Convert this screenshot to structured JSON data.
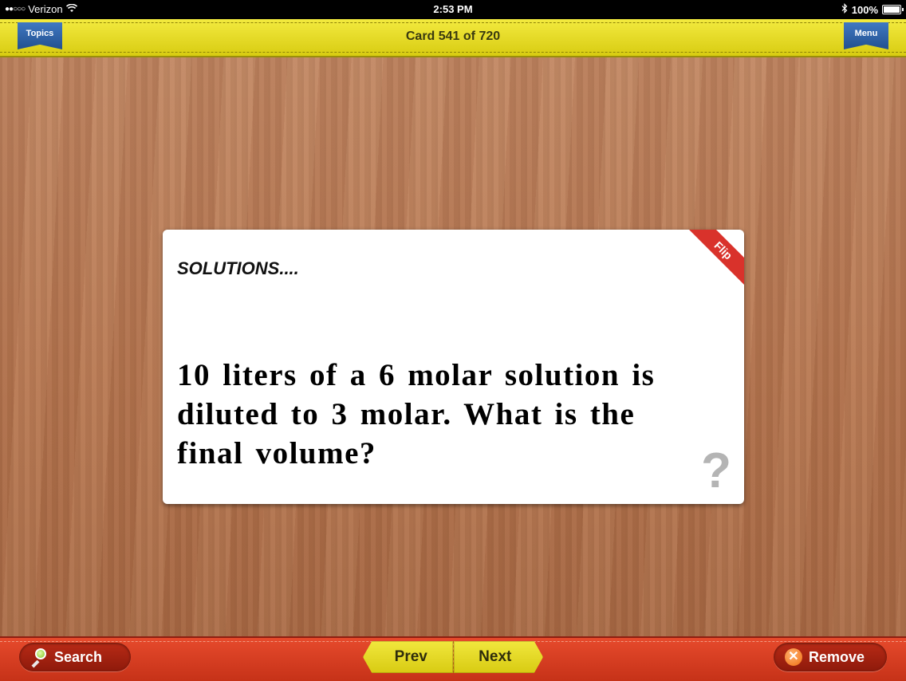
{
  "status_bar": {
    "carrier": "Verizon",
    "time": "2:53 PM",
    "battery": "100%",
    "battery_level": 1.0,
    "icons": [
      "signal-dots-icon",
      "wifi-icon",
      "bluetooth-icon",
      "battery-icon"
    ]
  },
  "header": {
    "topics_label": "Topics",
    "title": "Card 541 of 720",
    "menu_label": "Menu"
  },
  "card": {
    "topic": "SOLUTIONS....",
    "question": "10 liters of a 6 molar solution is diluted to 3 molar. What is the final volume?",
    "flip_label": "Flip",
    "hint_icon": "?"
  },
  "footer": {
    "search_label": "Search",
    "prev_label": "Prev",
    "next_label": "Next",
    "remove_label": "Remove",
    "remove_icon": "✕"
  },
  "colors": {
    "top_bar": "#e8dd2a",
    "ribbon": "#2f63a8",
    "bottom_bar": "#d63c20",
    "flip_ribbon": "#d9322b",
    "wood": "#b97a55"
  }
}
